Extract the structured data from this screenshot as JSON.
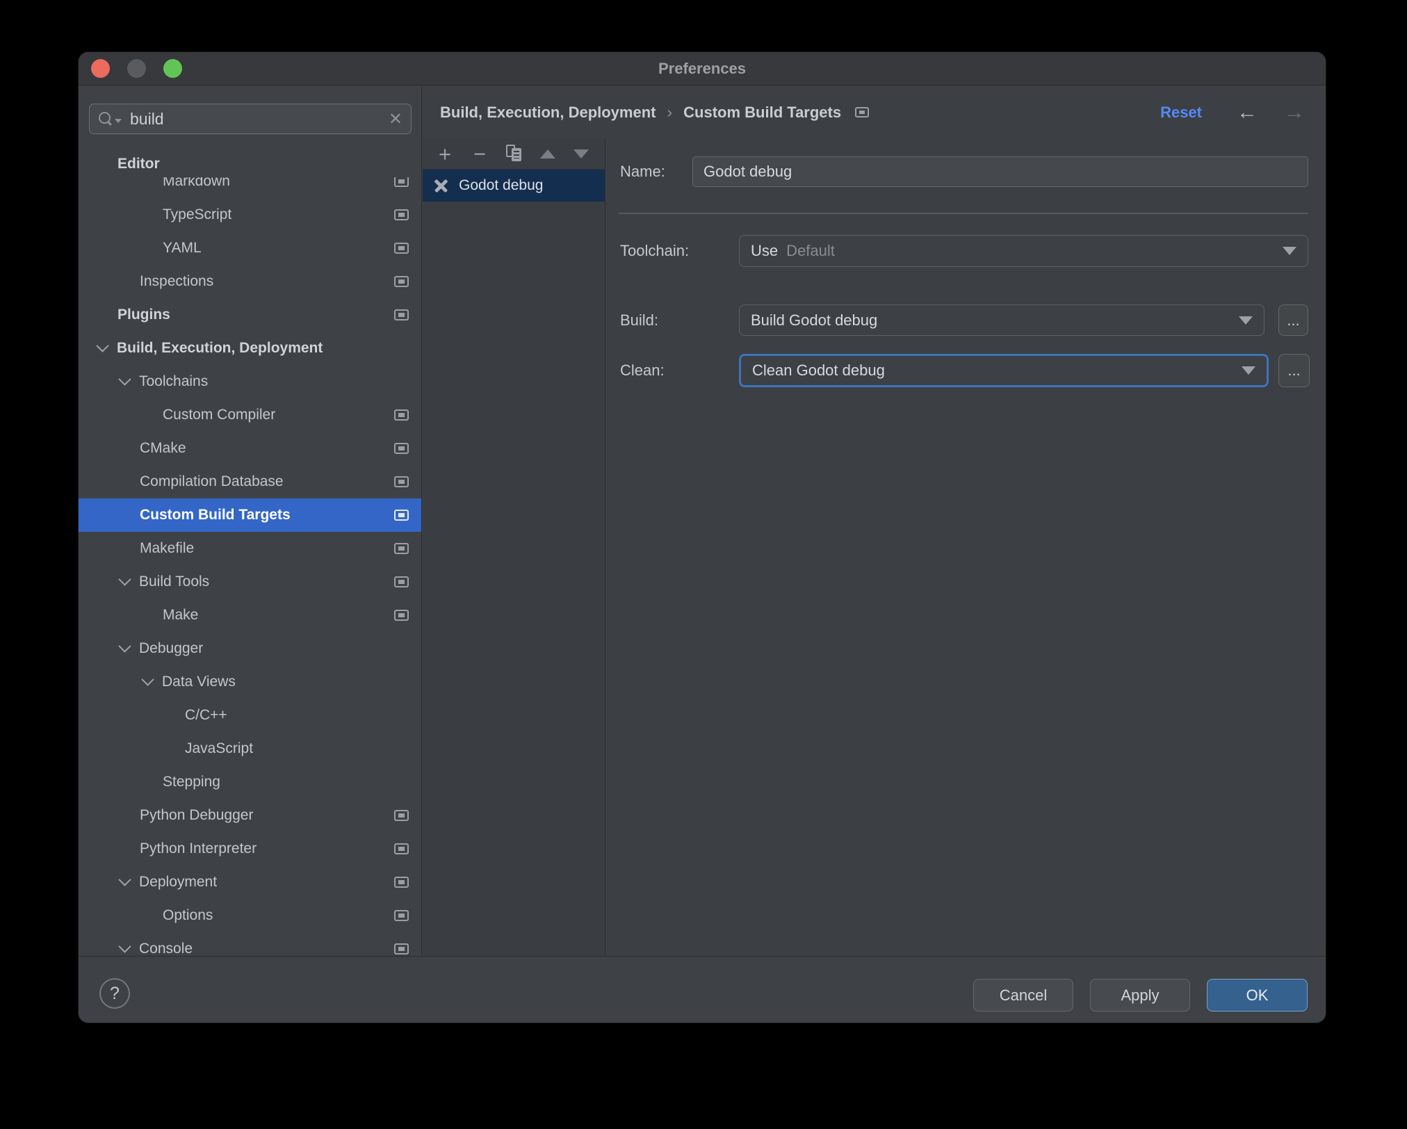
{
  "colors": {
    "tree_selection_blue": "#3366c6",
    "list_selection_navy": "#142e4f",
    "focus_ring_blue": "#3d73bd",
    "link_blue": "#548af7",
    "ok_button_blue": "#35618f",
    "panel_bg": "#3c3f43"
  },
  "window": {
    "title": "Preferences"
  },
  "search": {
    "value": "build"
  },
  "sidebar": {
    "items": [
      {
        "label": "Editor"
      },
      {
        "label": "Markdown"
      },
      {
        "label": "TypeScript"
      },
      {
        "label": "YAML"
      },
      {
        "label": "Inspections"
      },
      {
        "label": "Plugins"
      },
      {
        "label": "Build, Execution, Deployment"
      },
      {
        "label": "Toolchains"
      },
      {
        "label": "Custom Compiler"
      },
      {
        "label": "CMake"
      },
      {
        "label": "Compilation Database"
      },
      {
        "label": "Custom Build Targets"
      },
      {
        "label": "Makefile"
      },
      {
        "label": "Build Tools"
      },
      {
        "label": "Make"
      },
      {
        "label": "Debugger"
      },
      {
        "label": "Data Views"
      },
      {
        "label": "C/C++"
      },
      {
        "label": "JavaScript"
      },
      {
        "label": "Stepping"
      },
      {
        "label": "Python Debugger"
      },
      {
        "label": "Python Interpreter"
      },
      {
        "label": "Deployment"
      },
      {
        "label": "Options"
      },
      {
        "label": "Console"
      }
    ]
  },
  "header": {
    "breadcrumb_1": "Build, Execution, Deployment",
    "breadcrumb_sep": "›",
    "breadcrumb_2": "Custom Build Targets",
    "reset": "Reset",
    "back": "←",
    "forward": "→"
  },
  "list": {
    "toolbar": {
      "add": "+",
      "remove": "−"
    },
    "items": [
      {
        "label": "Godot debug"
      }
    ]
  },
  "form": {
    "name_label": "Name:",
    "name_value": "Godot debug",
    "toolchain_label": "Toolchain:",
    "toolchain_prefix": "Use",
    "toolchain_value": "Default",
    "build_label": "Build:",
    "build_value": "Build Godot debug",
    "clean_label": "Clean:",
    "clean_value": "Clean Godot debug",
    "browse": "..."
  },
  "footer": {
    "help": "?",
    "cancel": "Cancel",
    "apply": "Apply",
    "ok": "OK"
  }
}
